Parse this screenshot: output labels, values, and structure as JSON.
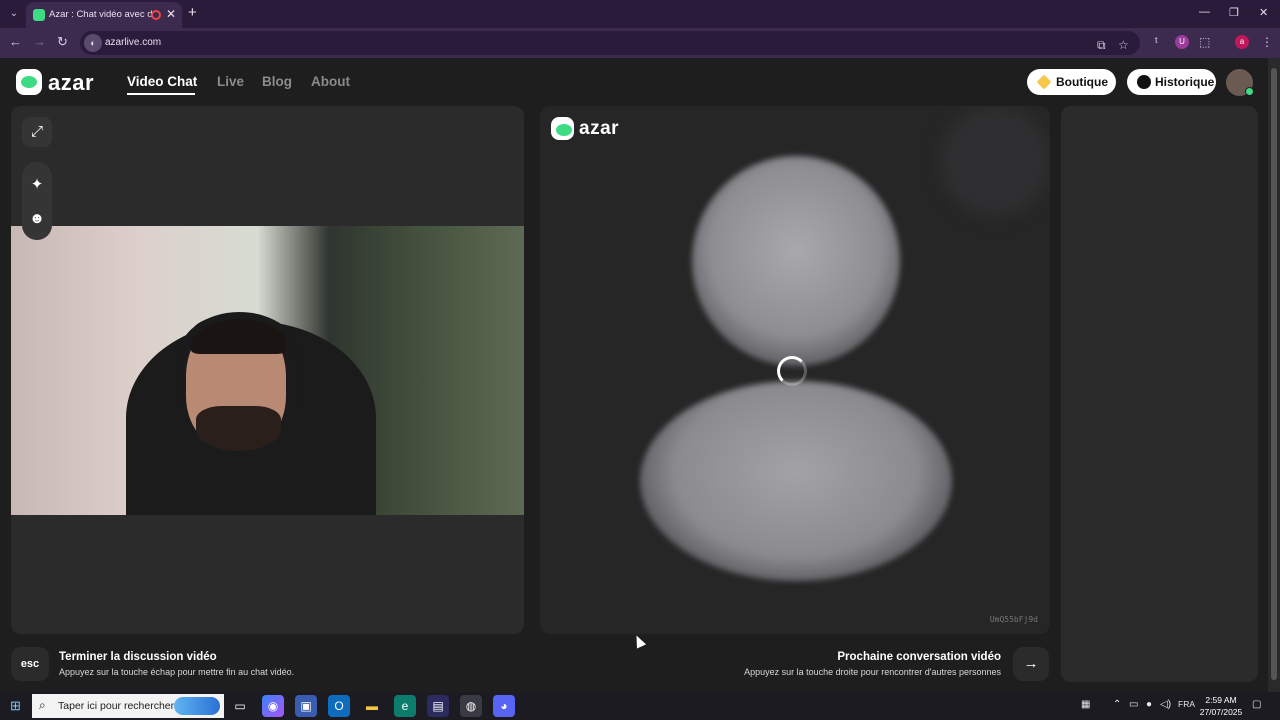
{
  "browser": {
    "tab_title": "Azar : Chat vidéo avec de n",
    "tab_close": "✕",
    "new_tab": "+",
    "url": "azarlive.com",
    "window_controls": [
      "—",
      "❐",
      "✕"
    ],
    "profile_initial": "a",
    "extension_labels": [
      "t",
      "U"
    ]
  },
  "site": {
    "logo_text": "azar",
    "nav": [
      "Video Chat",
      "Live",
      "Blog",
      "About"
    ],
    "active_nav": "Video Chat",
    "boutique_label": "Boutique",
    "historique_label": "Historique"
  },
  "video": {
    "peer_id": "UmQ55bFj9d"
  },
  "actions": {
    "esc_key": "esc",
    "end_title": "Terminer la discussion vidéo",
    "end_sub": "Appuyez sur la touche échap pour mettre fin au chat vidéo.",
    "next_title": "Prochaine conversation vidéo",
    "next_sub": "Appuyez sur la touche droite pour rencontrer d'autres personnes",
    "next_arrow": "→"
  },
  "taskbar": {
    "search_placeholder": "Taper ici pour rechercher",
    "language": "FRA",
    "time": "2:59 AM",
    "date": "27/07/2025"
  },
  "colors": {
    "accent_green": "#3ddc84",
    "browser_frame": "#2b1b3b",
    "page_bg": "#1e1e1e"
  }
}
